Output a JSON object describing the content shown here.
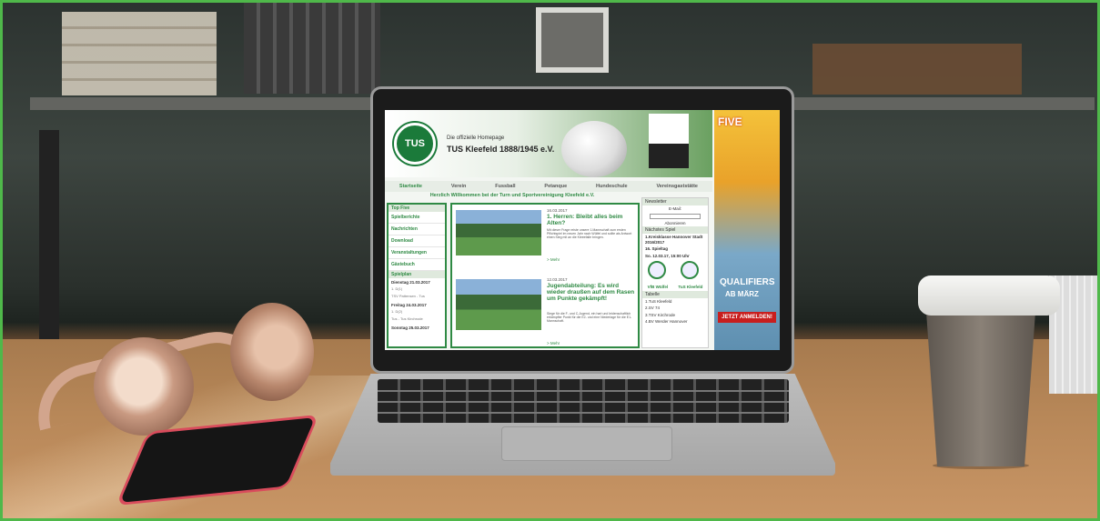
{
  "site": {
    "header_subtitle": "Die offizielle Homepage",
    "header_title": "TUS Kleefeld 1888/1945 e.V.",
    "logo_text": "TUS",
    "nav": [
      "Startseite",
      "Verein",
      "Fussball",
      "Petanque",
      "Hundeschule",
      "Vereinsgaststätte"
    ],
    "welcome": "Herzlich Willkommen bei der Turn und Sportvereinigung Kleefeld e.V.",
    "left": {
      "topfive_header": "Top Five",
      "links": [
        "Spielberichte",
        "Nachrichten",
        "Download",
        "Veranstaltungen",
        "Gästebuch"
      ],
      "schedule_header": "Spielplan",
      "days": [
        {
          "date": "Dienstag 21.03.2017",
          "time": "1. D(1)",
          "match": "TSV Pattensen - Tus"
        },
        {
          "date": "Freitag 24.03.2017",
          "time": "1. D(2)",
          "match": "Tus - Tus Kirchrode"
        },
        {
          "date": "Sonntag 25.03.2017",
          "time": "",
          "match": ""
        }
      ]
    },
    "news": [
      {
        "date": "16.03.2017",
        "title": "1. Herren: Bleibt alles beim Alten?",
        "text": "Mit dieser Frage reiste unsere 1.Mannschaft zum ersten Pflichtspiel im neuen Jahr nach Wülfel und sollte als Antwort einen Sieg mit an die Kleeefalle bringen.",
        "more": "> Mehr"
      },
      {
        "date": "12.03.2017",
        "title": "Jugendabteilung: Es wird wieder draußen auf dem Rasen um Punkte gekämpft!",
        "text": "Siege für die F- und C-Jugend, ein hart und leidenschaftlich erkämpfter Punkt für die E2- und eine Niederlage für die E1-Mannschaft.",
        "more": "> Mehr"
      }
    ],
    "right": {
      "newsletter_header": "Newsletter",
      "email_label": "E-Mail:",
      "subscribe": "Abonnieren",
      "next_header": "Nächstes Spiel",
      "next_league": "1.Kreisklasse Hannover Stadt 2016/2017",
      "next_round": "16. Spieltag",
      "next_date": "So. 12.03.17, 15:00 Uhr",
      "team_a": "VfB Wülfel",
      "team_b": "TuS Kleefeld",
      "table_header": "Tabelle",
      "table_rows": [
        "1.TuS Kleefeld",
        "2.SV 74",
        "3.TSV Kirchrode",
        "4.BV Werder Hannover"
      ]
    },
    "ad": {
      "top": "FIVE",
      "q1": "QUALIFIERS",
      "q2": "AB MÄRZ",
      "button": "JETZT ANMELDEN!"
    }
  }
}
